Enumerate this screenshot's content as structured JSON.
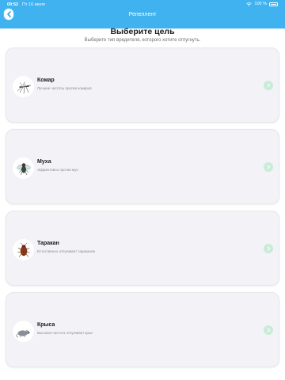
{
  "status_bar": {
    "time": "09:52",
    "date": "Пт 10 июля",
    "battery": "100 %",
    "wifi_icon": "wifi-icon",
    "battery_icon": "battery-icon"
  },
  "header": {
    "title": "Репеллент",
    "back_icon": "chevron-left-icon",
    "accent_color": "#3fb2ef"
  },
  "main": {
    "title": "Выберите цель",
    "subtitle": "Выберите тип вредителя, которого хотите отпугнуть.",
    "items": [
      {
        "name": "Комар",
        "description": "Лучшие частоты против комаров",
        "icon": "mosquito-icon"
      },
      {
        "name": "Муха",
        "description": "Эффективно против мух",
        "icon": "fly-icon"
      },
      {
        "name": "Таракан",
        "description": "Естественно отпугивает тараканов",
        "icon": "cockroach-icon"
      },
      {
        "name": "Крыса",
        "description": "Высокая частота отпугивает крыс",
        "icon": "rat-icon"
      }
    ],
    "chevron_icon": "chevron-right-icon",
    "chevron_color": "#c9ecd8"
  }
}
